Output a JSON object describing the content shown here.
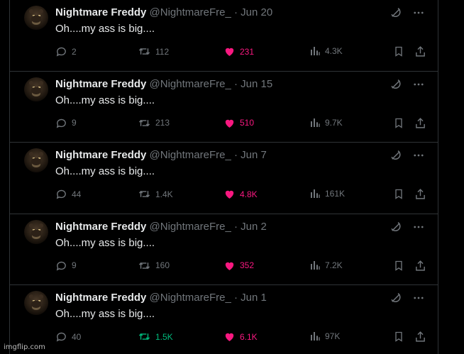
{
  "colors": {
    "background": "#000000",
    "text": "#e7e9ea",
    "muted": "#71767b",
    "like": "#f91880",
    "retweet_active": "#00ba7c",
    "border": "#2f3336"
  },
  "icons": [
    "grok-icon",
    "more-icon",
    "reply-icon",
    "retweet-icon",
    "like-icon",
    "views-icon",
    "bookmark-icon",
    "share-icon"
  ],
  "tweets": [
    {
      "name": "Nightmare Freddy",
      "handle": "@NightmareFre_",
      "dot": "·",
      "date": "Jun 20",
      "text": "Oh....my ass is big....",
      "replies": "2",
      "retweets": "112",
      "likes": "231",
      "views": "4.3K",
      "retweeted": false
    },
    {
      "name": "Nightmare Freddy",
      "handle": "@NightmareFre_",
      "dot": "·",
      "date": "Jun 15",
      "text": "Oh....my ass is big....",
      "replies": "9",
      "retweets": "213",
      "likes": "510",
      "views": "9.7K",
      "retweeted": false
    },
    {
      "name": "Nightmare Freddy",
      "handle": "@NightmareFre_",
      "dot": "·",
      "date": "Jun 7",
      "text": "Oh....my ass is big....",
      "replies": "44",
      "retweets": "1.4K",
      "likes": "4.8K",
      "views": "161K",
      "retweeted": false
    },
    {
      "name": "Nightmare Freddy",
      "handle": "@NightmareFre_",
      "dot": "·",
      "date": "Jun 2",
      "text": "Oh....my ass is big....",
      "replies": "9",
      "retweets": "160",
      "likes": "352",
      "views": "7.2K",
      "retweeted": false
    },
    {
      "name": "Nightmare Freddy",
      "handle": "@NightmareFre_",
      "dot": "·",
      "date": "Jun 1",
      "text": "Oh....my ass is big....",
      "replies": "40",
      "retweets": "1.5K",
      "likes": "6.1K",
      "views": "97K",
      "retweeted": true
    }
  ],
  "watermark": "imgflip.com"
}
